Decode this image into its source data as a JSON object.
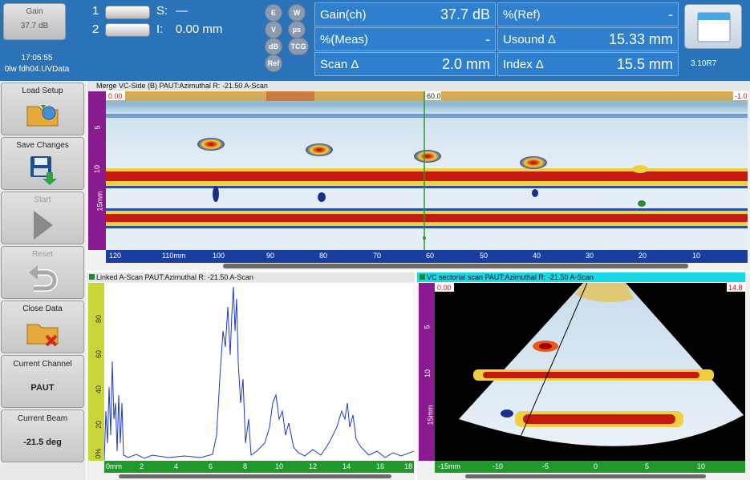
{
  "top": {
    "gain_button": {
      "label": "Gain",
      "value": "37.7 dB"
    },
    "time": "17:05:55",
    "file": "0lw fdh04.UVData",
    "cursors": [
      {
        "num": "1",
        "label": "S:",
        "value": "—"
      },
      {
        "num": "2",
        "label": "I:",
        "value": "0.00 mm"
      }
    ],
    "mode_buttons": [
      "E",
      "W",
      "V",
      "µs",
      "dB",
      "TCG",
      "Ref"
    ],
    "readings": [
      {
        "label": "Gain(ch)",
        "value": "37.7 dB"
      },
      {
        "label": "%(Ref)",
        "value": "-"
      },
      {
        "label": "%(Meas)",
        "value": "-"
      },
      {
        "label": "Usound Δ",
        "value": "15.33 mm"
      },
      {
        "label": "Scan Δ",
        "value": "2.0 mm"
      },
      {
        "label": "Index Δ",
        "value": "15.5 mm"
      }
    ],
    "version": "3.10R7"
  },
  "sidebar": {
    "buttons": [
      {
        "label": "Load Setup",
        "icon": "folder-load-icon"
      },
      {
        "label": "Save Changes",
        "icon": "save-disk-icon"
      },
      {
        "label": "Start",
        "icon": "play-icon"
      },
      {
        "label": "Reset",
        "icon": "reset-arrow-icon"
      },
      {
        "label": "Close Data",
        "icon": "close-folder-icon"
      }
    ],
    "current_channel": {
      "label": "Current Channel",
      "value": "PAUT"
    },
    "current_beam": {
      "label": "Current Beam",
      "value": "-21.5 deg"
    }
  },
  "bscan": {
    "title": "Merge VC-Side (B) PAUT:Azimuthal   R: -21.50 A-Scan",
    "left_value": "0.00",
    "cursor_value": "60.0",
    "right_value": "-1.0",
    "depth_ticks": [
      "5",
      "10",
      "15mm"
    ],
    "x_ticks": [
      "120",
      "110mm",
      "100",
      "90",
      "80",
      "70",
      "60",
      "50",
      "40",
      "30",
      "20",
      "10"
    ]
  },
  "ascan": {
    "title": "Linked A-Scan PAUT:Azimuthal   R: -21.50 A-Scan",
    "y_ticks": [
      "80",
      "60",
      "40",
      "20",
      "0%"
    ],
    "x_ticks": [
      "0mm",
      "2",
      "4",
      "6",
      "8",
      "10",
      "12",
      "14",
      "16",
      "18"
    ]
  },
  "sscan": {
    "title": "VC sectorial scan PAUT:Azimuthal   R: -21.50 A-Scan",
    "left_value": "0.00",
    "right_value": "14.8",
    "depth_ticks": [
      "5",
      "10",
      "15mm"
    ],
    "x_ticks": [
      "-15mm",
      "-10",
      "-5",
      "0",
      "5",
      "10"
    ]
  },
  "colors": {
    "header": "#2a73b8",
    "reading_cell": "#2e7fcd",
    "ruler_purple": "#8a1a8f",
    "ruler_green": "#1f9a2a",
    "ruler_blue": "#1a3ea0"
  }
}
